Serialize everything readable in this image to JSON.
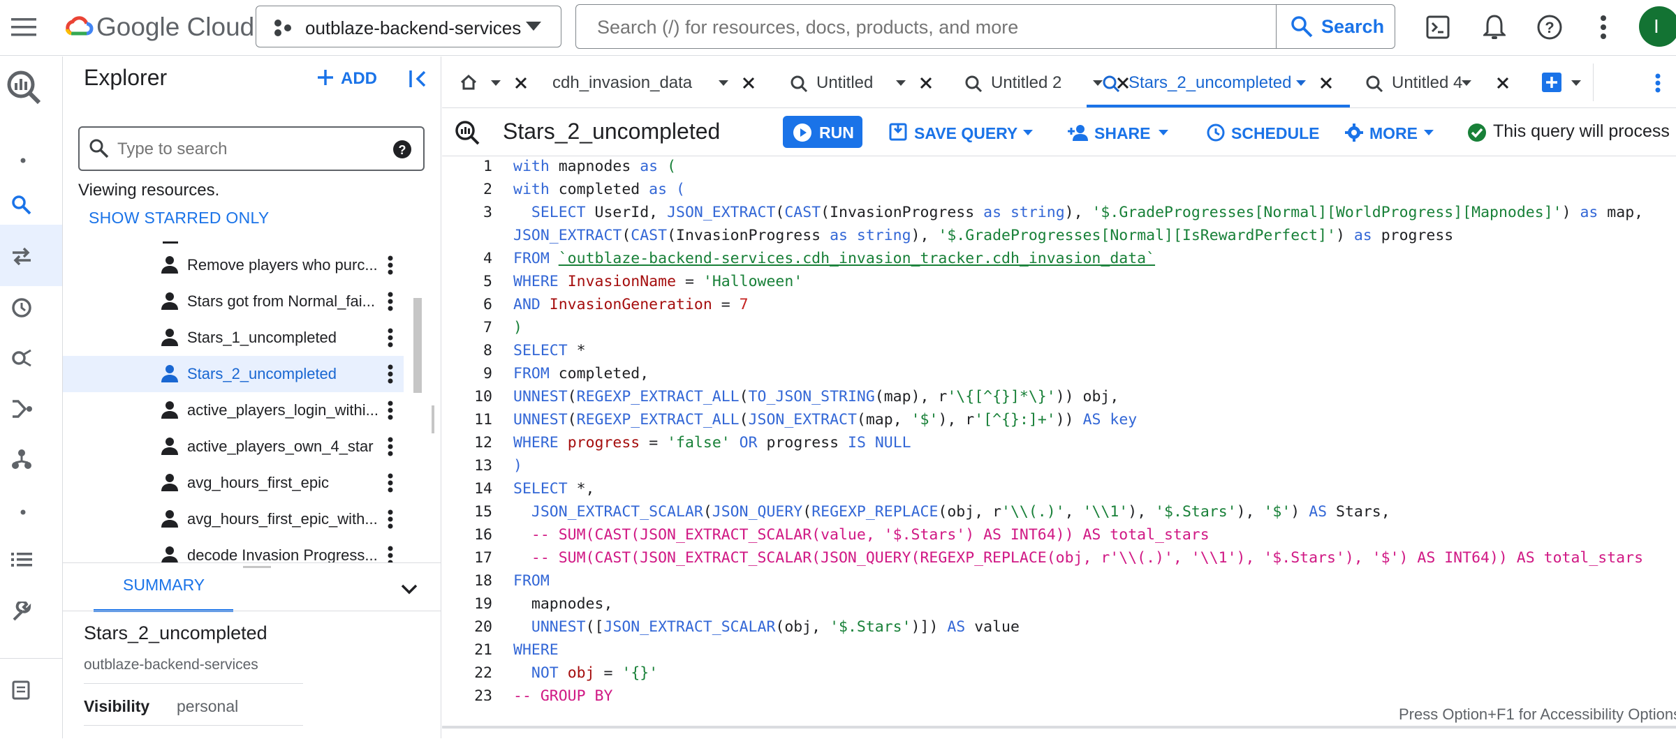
{
  "topbar": {
    "menu_icon": "hamburger-menu-icon",
    "logo_text": "Google Cloud",
    "project": "outblaze-backend-services",
    "search_placeholder": "Search (/) for resources, docs, products, and more",
    "search_button": "Search",
    "icons": [
      "cloud-shell-icon",
      "bell-icon",
      "help-icon",
      "more-vert-icon"
    ],
    "avatar_letter": "I"
  },
  "explorer": {
    "title": "Explorer",
    "add_label": "ADD",
    "search_placeholder": "Type to search",
    "viewing": "Viewing resources.",
    "show_starred": "SHOW STARRED ONLY",
    "items": [
      {
        "label": "Remove players who purc..."
      },
      {
        "label": "Stars got from Normal_fai..."
      },
      {
        "label": "Stars_1_uncompleted"
      },
      {
        "label": "Stars_2_uncompleted",
        "selected": true
      },
      {
        "label": "active_players_login_withi..."
      },
      {
        "label": "active_players_own_4_star"
      },
      {
        "label": "avg_hours_first_epic"
      },
      {
        "label": "avg_hours_first_epic_with..."
      },
      {
        "label": "decode Invasion Progress..."
      }
    ]
  },
  "summary": {
    "tab_label": "SUMMARY",
    "title": "Stars_2_uncompleted",
    "project": "outblaze-backend-services",
    "visibility_label": "Visibility",
    "visibility_value": "personal"
  },
  "tabs": [
    {
      "label": "cdh_invasion_data"
    },
    {
      "label": "Untitled"
    },
    {
      "label": "Untitled 2"
    },
    {
      "label": "Stars_2_uncompleted",
      "active": true
    },
    {
      "label": "Untitled 4"
    }
  ],
  "query_toolbar": {
    "title": "Stars_2_uncompleted",
    "run": "RUN",
    "save_query": "SAVE QUERY",
    "share": "SHARE",
    "schedule": "SCHEDULE",
    "more": "MORE",
    "status": "This query will process ..."
  },
  "editor": {
    "line_numbers": [
      "1",
      "2",
      "3",
      "",
      "4",
      "5",
      "6",
      "7",
      "8",
      "9",
      "10",
      "11",
      "12",
      "13",
      "14",
      "15",
      "16",
      "17",
      "18",
      "19",
      "20",
      "21",
      "22",
      "23"
    ],
    "accessibility_hint": "Press Option+F1 for Accessibility Options"
  },
  "colors": {
    "accent": "#1a73e8",
    "keyword": "#3367d6",
    "string": "#188038",
    "number": "#c5221f",
    "comment": "#d01884"
  }
}
